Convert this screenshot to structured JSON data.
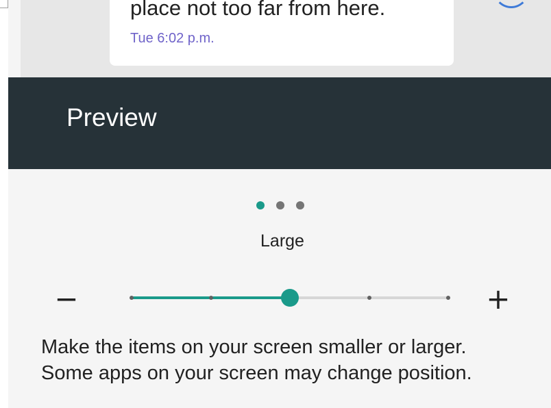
{
  "message_preview": {
    "text": "place not too far from here.",
    "timestamp": "Tue 6:02 p.m."
  },
  "preview_header": {
    "title": "Preview"
  },
  "page_indicator": {
    "count": 3,
    "active_index": 0
  },
  "size_setting": {
    "label": "Large",
    "decrease_label": "−",
    "increase_label": "+",
    "steps": 5,
    "selected_step": 3,
    "value_fraction": 0.5
  },
  "description": {
    "line1": "Make the items on your screen smaller or larger.",
    "line2": "Some apps on your screen may change position."
  },
  "colors": {
    "accent": "#1a9a8a",
    "header_bg": "#263238",
    "timestamp": "#6f63c9",
    "inactive_dot": "#757575"
  }
}
